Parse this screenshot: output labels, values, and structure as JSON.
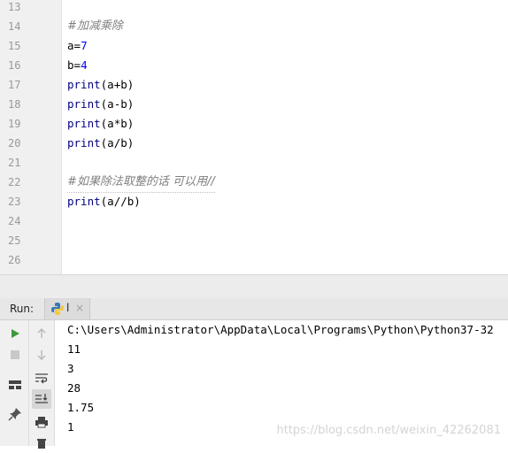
{
  "editor": {
    "lines": [
      {
        "n": "13"
      },
      {
        "n": "14"
      },
      {
        "n": "15"
      },
      {
        "n": "16"
      },
      {
        "n": "17"
      },
      {
        "n": "18"
      },
      {
        "n": "19"
      },
      {
        "n": "20"
      },
      {
        "n": "21"
      },
      {
        "n": "22"
      },
      {
        "n": "23"
      },
      {
        "n": "24"
      },
      {
        "n": "25"
      },
      {
        "n": "26"
      }
    ],
    "code": {
      "l14": "#加减乘除",
      "l15_var": "a=",
      "l15_num": "7",
      "l16_var": "b=",
      "l16_num": "4",
      "l17_fn": "print",
      "l17_args": "(a+b)",
      "l18_fn": "print",
      "l18_args": "(a-b)",
      "l19_fn": "print",
      "l19_args": "(a*b)",
      "l20_fn": "print",
      "l20_args": "(a/b)",
      "l22": "#如果除法取整的话 可以用//",
      "l23_fn": "print",
      "l23_args": "(a//b)"
    }
  },
  "run": {
    "title": "Run:",
    "tab_label": "l",
    "tab_close": "×"
  },
  "console": {
    "command": "C:\\Users\\Administrator\\AppData\\Local\\Programs\\Python\\Python37-32",
    "outputs": [
      "11",
      "3",
      "28",
      "1.75",
      "1"
    ]
  },
  "watermark": "https://blog.csdn.net/weixin_42262081",
  "colors": {
    "keyword": "#000080",
    "number": "#0000ff",
    "comment": "#808080",
    "run_green": "#3c9a3c"
  }
}
